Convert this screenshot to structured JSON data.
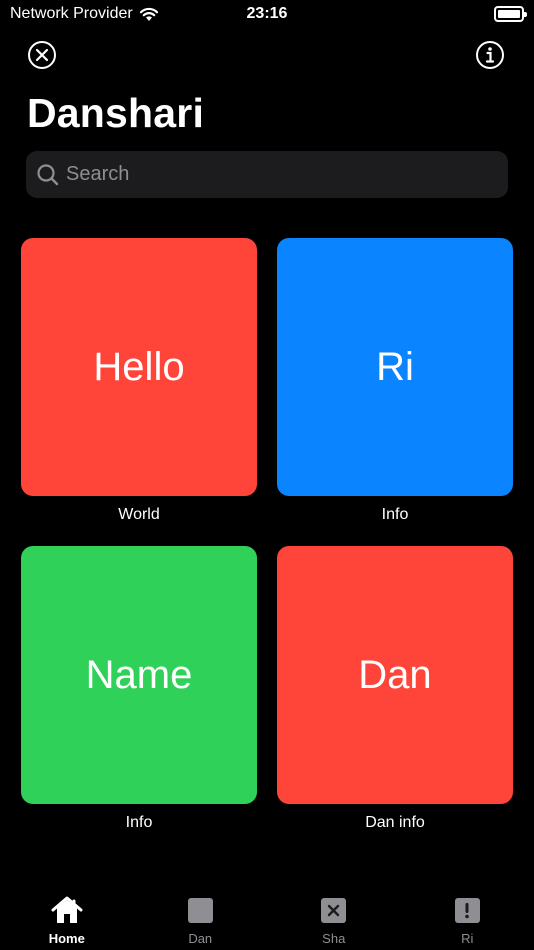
{
  "status_bar": {
    "carrier": "Network Provider",
    "time": "23:16",
    "battery_level": 1.0
  },
  "nav": {
    "close_icon": "close-icon",
    "info_icon": "info-icon"
  },
  "page_title": "Danshari",
  "search": {
    "placeholder": "Search"
  },
  "tiles": [
    {
      "label": "Hello",
      "caption": "World",
      "color": "#ff453a"
    },
    {
      "label": "Ri",
      "caption": "Info",
      "color": "#0a84ff"
    },
    {
      "label": "Name",
      "caption": "Info",
      "color": "#30d158"
    },
    {
      "label": "Dan",
      "caption": "Dan info",
      "color": "#ff453a"
    }
  ],
  "tab_bar": {
    "tabs": [
      {
        "label": "Home",
        "icon": "house-icon",
        "active": true
      },
      {
        "label": "Dan",
        "icon": "square-icon",
        "active": false
      },
      {
        "label": "Sha",
        "icon": "xmark-square-icon",
        "active": false
      },
      {
        "label": "Ri",
        "icon": "exclamation-square-icon",
        "active": false
      }
    ]
  }
}
